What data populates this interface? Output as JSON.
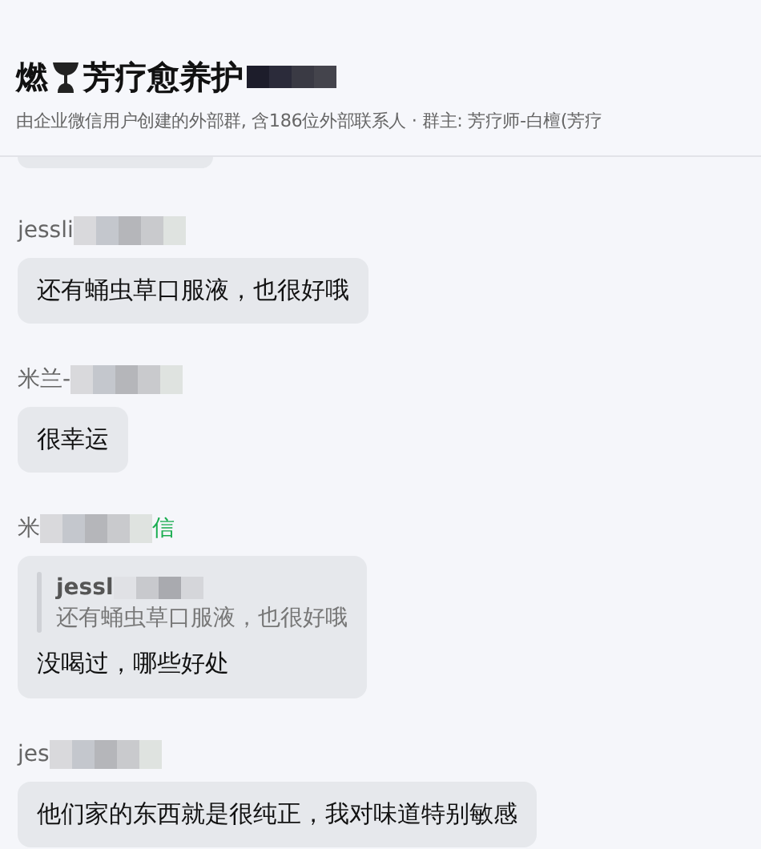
{
  "header": {
    "title_lead": "燃",
    "title": "芳疗愈养护",
    "title_redacted": true,
    "subtitle": "由企业微信用户创建的外部群, 含186位外部联系人 · 群主: 芳疗师-白檀(芳疗"
  },
  "messages": [
    {
      "kind": "cut_off"
    },
    {
      "kind": "text",
      "sender": "jessli",
      "sender_redacted": true,
      "text": "还有蛹虫草口服液，也很好哦"
    },
    {
      "kind": "text",
      "sender": "米兰-",
      "sender_redacted": true,
      "text": "很幸运"
    },
    {
      "kind": "quote",
      "sender": "米",
      "sender_redacted": true,
      "sender_suffix": "信",
      "quote_sender": "jessl",
      "quote_redacted": true,
      "quote_text": "还有蛹虫草口服液，也很好哦",
      "text": "没喝过，哪些好处"
    },
    {
      "kind": "text",
      "sender": "jes",
      "sender_redacted": true,
      "text": "他们家的东西就是很纯正，我对味道特别敏感"
    }
  ]
}
